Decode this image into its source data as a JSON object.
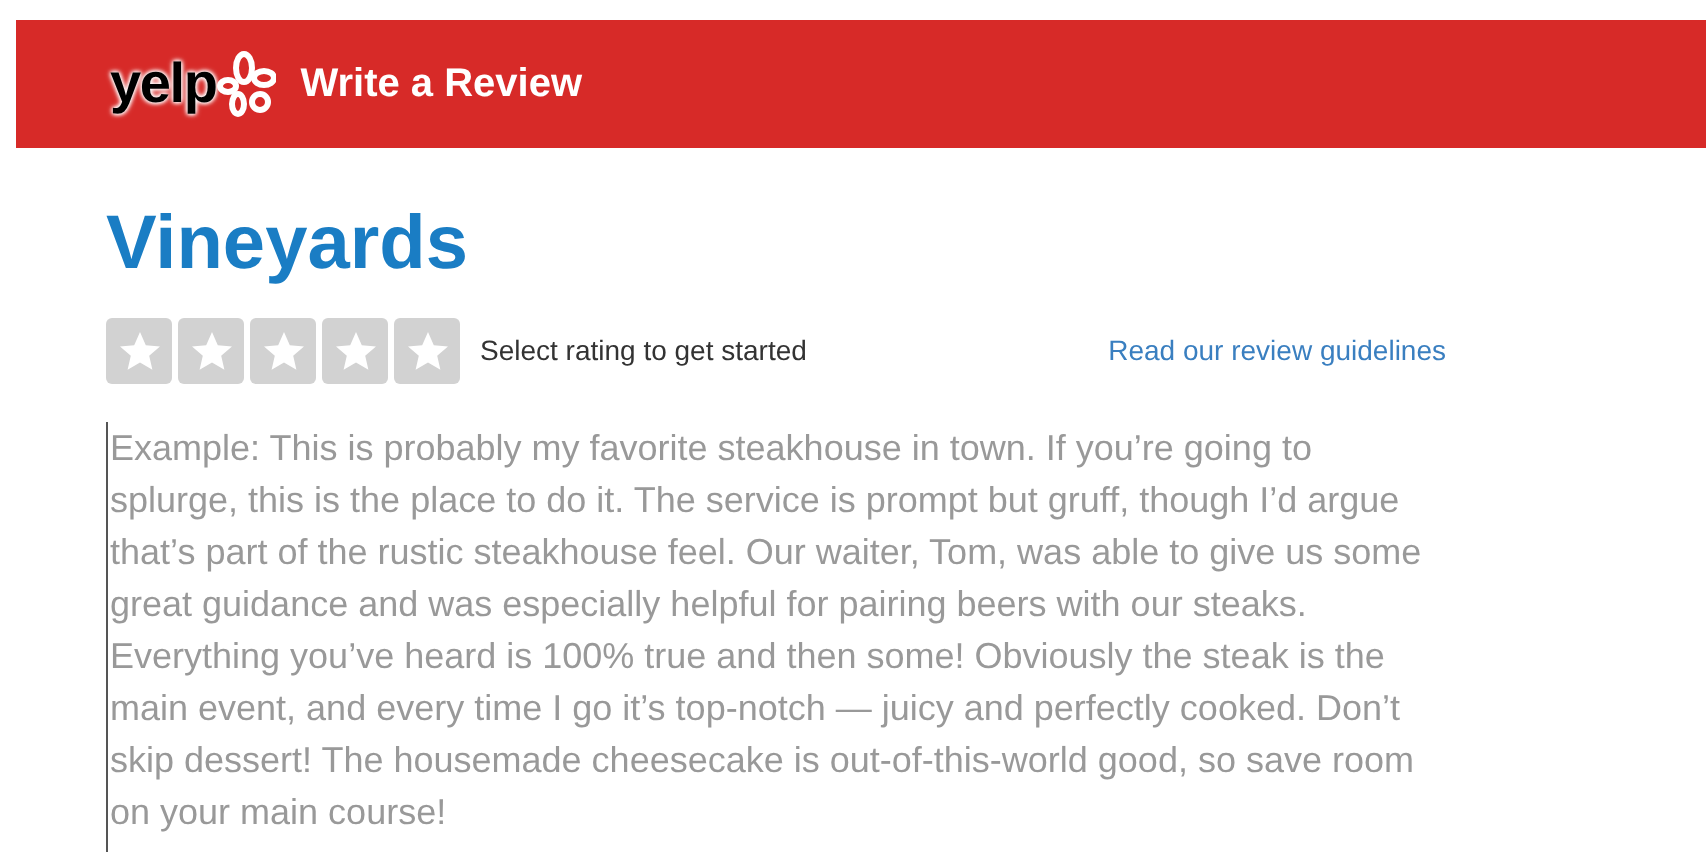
{
  "header": {
    "logo": "yelp",
    "title": "Write a Review"
  },
  "business": {
    "name": "Vineyards"
  },
  "rating": {
    "stars": 0,
    "prompt": "Select rating to get started",
    "guidelines_link": "Read our review guidelines"
  },
  "review": {
    "placeholder": "Example: This is probably my favorite steakhouse in town. If you’re going to splurge, this is the place to do it. The service is prompt but gruff, though I’d argue that’s part of the rustic steakhouse feel. Our waiter, Tom, was able to give us some great guidance and was especially helpful for pairing beers with our steaks. Everything you’ve heard is 100% true and then some! Obviously the steak is the main event, and every time I go it’s top-notch — juicy and perfectly cooked. Don’t skip dessert! The housemade cheesecake is out-of-this-world good, so save room on your main course!"
  }
}
